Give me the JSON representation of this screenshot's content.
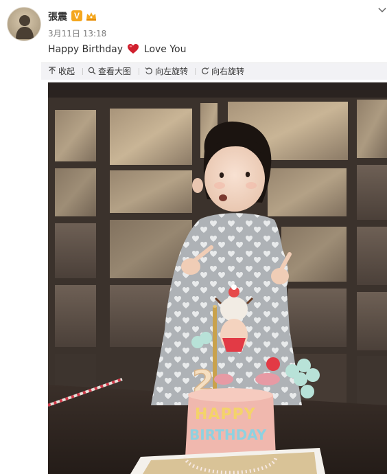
{
  "post": {
    "author": "張震",
    "verified_badge": "V",
    "timestamp": "3月11日 13:18",
    "text_before": "Happy Birthday",
    "text_after": "Love You",
    "emoji": "heart-icon"
  },
  "toolbar": {
    "collapse": "收起",
    "view_large": "查看大图",
    "rotate_left": "向左旋转",
    "rotate_right": "向右旋转"
  },
  "photo": {
    "cake_number": "2",
    "cake_text_line1": "HAPPY",
    "cake_text_line2": "BIRTHDAY"
  },
  "colors": {
    "accent_badge": "#f4a71f",
    "toolbar_bg": "#f2f2f5",
    "heart": "#d0202e"
  }
}
